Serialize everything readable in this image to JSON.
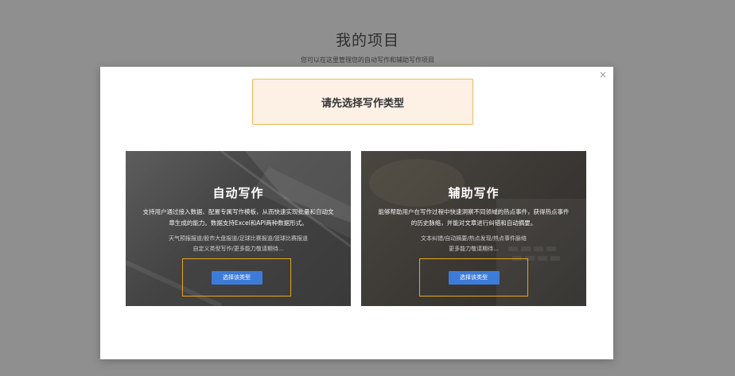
{
  "page": {
    "title": "我的项目",
    "subtitle": "您可以在这里管理您的自动写作和辅助写作项目"
  },
  "modal": {
    "close_icon": "×",
    "notice": "请先选择写作类型",
    "cards": [
      {
        "title": "自动写作",
        "desc": "支持用户通过接入数据、配置专属写作模板，从而快速实现批量和自动文章生成的能力。数据支持Excel和API两种数据形式。",
        "tags_line1": "天气预报报道/股市大盘报道/足球比赛报道/篮球比赛报道",
        "tags_line2": "自定义类型写作/更多能力敬请期待...",
        "button": "选择该类型"
      },
      {
        "title": "辅助写作",
        "desc": "能够帮助用户在写作过程中快速洞察不同领域的热点事件，获得热点事件的历史脉络，并能对文章进行纠错和自动摘要。",
        "tags_line1": "文本纠错/自动摘要/热点发现/热点事件脉络",
        "tags_line2": "更多能力敬请期待...",
        "button": "选择该类型"
      }
    ]
  },
  "colors": {
    "backdrop": "#8f8f8f",
    "notice_bg": "#fdf1e6",
    "notice_border": "#f0b95a",
    "highlight_border": "#e8a521",
    "button": "#3d7bd9"
  }
}
